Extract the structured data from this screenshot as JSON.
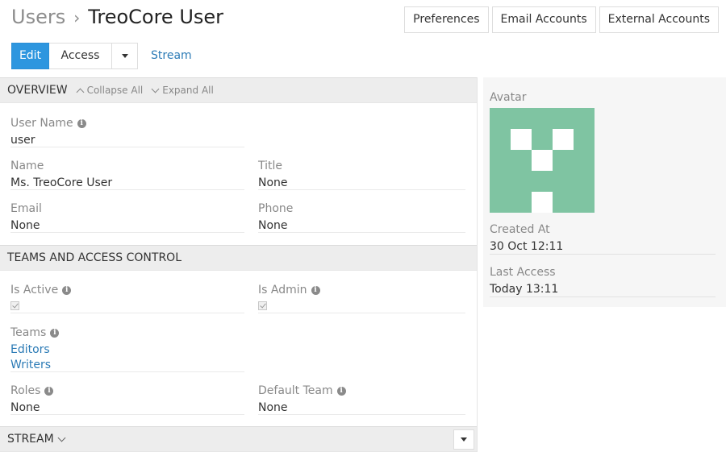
{
  "header": {
    "breadcrumb_parent": "Users",
    "breadcrumb_separator": "›",
    "breadcrumb_current": "TreoCore User",
    "buttons": [
      "Preferences",
      "Email Accounts",
      "External Accounts"
    ]
  },
  "actions": {
    "edit": "Edit",
    "access": "Access",
    "stream": "Stream"
  },
  "overview": {
    "title": "OVERVIEW",
    "collapse_all": "Collapse All",
    "expand_all": "Expand All",
    "user_name_label": "User Name",
    "user_name": "user",
    "name_label": "Name",
    "name": "Ms. TreoCore User",
    "title_label": "Title",
    "title_value": "None",
    "email_label": "Email",
    "email": "None",
    "phone_label": "Phone",
    "phone": "None"
  },
  "teams": {
    "title": "TEAMS AND ACCESS CONTROL",
    "is_active_label": "Is Active",
    "is_active": true,
    "is_admin_label": "Is Admin",
    "is_admin": true,
    "teams_label": "Teams",
    "teams": [
      "Editors",
      "Writers"
    ],
    "roles_label": "Roles",
    "roles": "None",
    "default_team_label": "Default Team",
    "default_team": "None"
  },
  "stream_panel": {
    "title": "STREAM"
  },
  "side": {
    "avatar_label": "Avatar",
    "avatar_color": "#7fc4a2",
    "created_at_label": "Created At",
    "created_at": "30 Oct 12:11",
    "last_access_label": "Last Access",
    "last_access": "Today 13:11"
  },
  "colors": {
    "primary": "#2d96df",
    "link": "#2c7bb6",
    "panel_header": "#ededed"
  }
}
